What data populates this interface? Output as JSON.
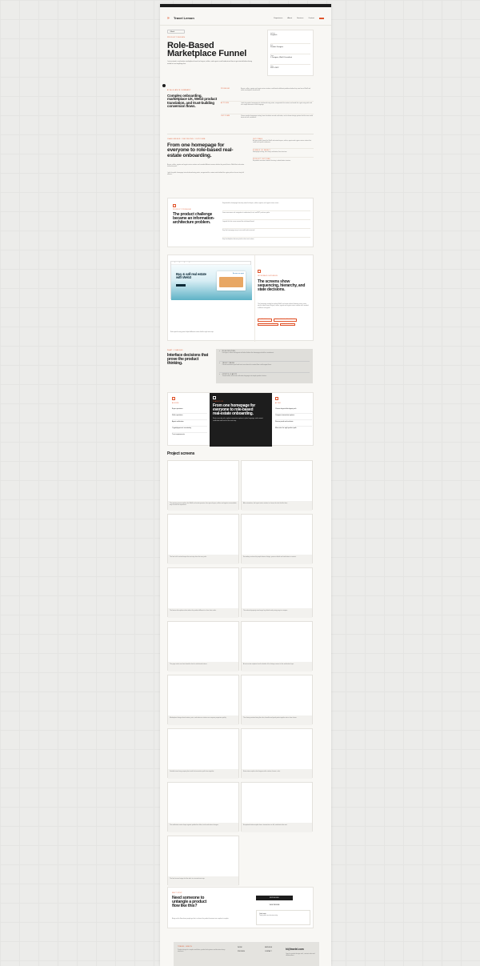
{
  "site": {
    "top_strip": "",
    "logo": "Travel Lemon",
    "nav": [
      "Experience",
      "About",
      "Services",
      "Contact"
    ],
    "nav_cta": ""
  },
  "hero": {
    "back": "Back",
    "eyebrow": "Product Design",
    "title": "Role-Based Marketplace Funnel",
    "description": "I restructured a real-estate marketplace funnel so buyers, sellers, and agents could understand how to get started before being asked to trust anything else.",
    "meta": [
      {
        "label": "Industry",
        "value": "Proptech"
      },
      {
        "label": "Role",
        "value": "Product Designer"
      },
      {
        "label": "Team",
        "value": "1 Designer, Web3 Consultant"
      },
      {
        "label": "Year",
        "value": "2021–2022"
      }
    ]
  },
  "summary": {
    "label": "At-a-glance summary",
    "title": "Complex onboarding, marketplace UX, Web3 product translation, and trust-building conversion flows.",
    "rows": [
      {
        "k": "Problem",
        "v": "Buyers, sellers, agents and crypto-curious visitors could land on different problems before they saw how a Web3 real estate marketplace should work."
      },
      {
        "k": "Actions",
        "v": "I split the product homepage into role-based entry points, reorganized the content, and made the crypto entry path read as a simple decision in clear language."
      },
      {
        "k": "Outcome",
        "v": "Clearer product homepage routing, lower hesitation around verification, and a cleaner design system that the team could iterate on with confidence."
      }
    ]
  },
  "challenge": {
    "label": "Challenges / Decisions / Outcome",
    "title": "From one homepage for everyone to role-based real-estate onboarding.",
    "body": "Buyers, sellers, agents and crypto-curious visitors each needed different answers before they would trust a Web3-first real-estate transaction path.",
    "body2": "I split the public homepage into role-based entry points, reorganized the content and clarified the crypto path so the next step felt obvious.",
    "side": [
      {
        "k": "Outcomes",
        "v": "A clearer public funnel for Web3 real-estate buyers, sellers, agents and crypto-curious visitors that could host specific audiences."
      },
      {
        "k": "Signals of impact",
        "v": "Homepage routing, role clarity, verification, flow structure."
      },
      {
        "k": "Product outcome",
        "v": "No product outcome claimed: the story is about better structure."
      }
    ]
  },
  "problem": {
    "label": "Product Problem",
    "title": "The product challenge became an information-architecture problem.",
    "points": [
      "Separated the homepage hierarchy aimed at buyers, sellers, agents, and crypto-curious users.",
      "Gave newcomers role navigation to understand, trust, and NFT purchase paths.",
      "Layered the first screen around the role-based funnel.",
      "Kept the homepage easy to scan and hard to misread.",
      "Kept marketplace discovery tied to clear next actions."
    ]
  },
  "screens_intro": {
    "label": "Interface Evidence",
    "title": "The screens show sequencing, hierarchy, and state decisions.",
    "body": "The homepage needed to explain Web3 real estate without flattening every visitor into the same funnel. Buyers, sellers, agents and crypto-curious visitors each needed a different entry path.",
    "tags": [
      "Homepage IA",
      "Role-based navigation",
      "Verification states",
      "Mobile flows"
    ],
    "mock_hero": "Buy & sell real estate with Web3",
    "mock_card": "Become an agent",
    "caption": "Role-specific entry points helped different visitors find the right next step."
  },
  "decisions": {
    "label": "What I changed",
    "title": "Interface decisions that prove the product thinking.",
    "items": [
      {
        "k": "Role routing",
        "v": "Let buyers, sellers and agents self-select before the homepage asked for commitment."
      },
      {
        "k": "Trust timing",
        "v": "Placed verification proof and trust cues where the content flow could support them."
      },
      {
        "k": "Crypto clarity",
        "v": "Turned wallet, token and verification language into simple product choices."
      }
    ]
  },
  "journey": {
    "before": {
      "label": "Before",
      "items": [
        "Buyer questions",
        "Seller questions",
        "Agent verification",
        "Crypto/payments uncertainty",
        "Trust requirements"
      ]
    },
    "center": {
      "label": "Transition",
      "title": "From one homepage for everyone to role-based real-estate onboarding.",
      "body": "Route users by role, explain transaction options in plain language, and connect verification and trust to the next step."
    },
    "after": {
      "label": "After",
      "items": [
        "Choose buyer/seller/agent path",
        "Compare transaction options",
        "Review proof and evaluate",
        "Move into the right product path"
      ]
    }
  },
  "project_screens": {
    "title": "Project screens",
    "captions": [
      "The opening screen explains the Web3 real-estate promise, then gives buyers, sellers and agents an immediate way to enter the experience.",
      "After orientation, the layout invites visitors to choose the role that fits them.",
      "The final call to action keeps the next step clear for every role.",
      "Secondary sections let people browse listings, process details and verification in context.",
      "The feature list explains what makes the product different in a few short cards.",
      "The selected property view keeps key details and pricing easy to compare.",
      "The page makes on-chain benefits clear for role-based visitors.",
      "A trust section explains how the details of the listings connect to the verification layer.",
      "Marketplace listings show location, price, and status so visitors can compare properties quickly.",
      "The closing sections bring the roles, benefits and proof points together into a clear choice.",
      "Detailed views keep property facts and the transaction path close together.",
      "Extra states explain what happens after visitors choose a role.",
      "The notification center keeps agents updated on offers, tasks and status changes.",
      "Exceptional states explain how a transaction can fail, and what to do next.",
      "The final screen brings the flow back to a trusted next step."
    ]
  },
  "cta": {
    "label": "Next step",
    "title": "Need someone to untangle a product flow like this?",
    "body": "Bring me the flow where people get lost, or where the product becomes too complex to explain.",
    "button": "Book a call",
    "link": "View resume",
    "mini_label": "Quick note",
    "mini_text": "I reply within one business day."
  },
  "footer": {
    "brand": "Travel Lemon",
    "desc": "Product design for complex workflows, product-led systems and decision-heavy interfaces.",
    "cols": [
      "Work",
      "Process",
      "Services",
      "Contact"
    ],
    "email": "hi@travlel.com",
    "note": "Open for product design work, contract roles and collaborations."
  },
  "colors": {
    "accent": "#e0532a",
    "dark": "#1d1d1d",
    "paper": "#f8f7f4"
  }
}
